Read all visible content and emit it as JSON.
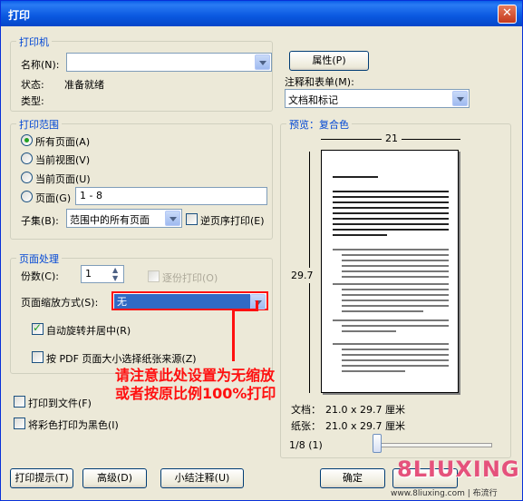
{
  "window": {
    "title": "打印",
    "close": "✕"
  },
  "printer": {
    "group_title": "打印机",
    "name_label": "名称(N):",
    "properties_button": "属性(P)",
    "status_label": "状态:",
    "status_value": "准备就绪",
    "type_label": "类型:",
    "comments_label": "注释和表单(M):",
    "comments_value": "文档和标记"
  },
  "range": {
    "group_title": "打印范围",
    "options": [
      "所有页面(A)",
      "当前视图(V)",
      "当前页面(U)",
      "页面(G)"
    ],
    "pages_value": "1 - 8",
    "subset_label": "子集(B):",
    "subset_value": "范围中的所有页面",
    "reverse_label": "逆页序打印(E)"
  },
  "handling": {
    "group_title": "页面处理",
    "copies_label": "份数(C):",
    "copies_value": "1",
    "collate_label": "逐份打印(O)",
    "scaling_label": "页面缩放方式(S):",
    "scaling_value": "无",
    "auto_rotate_label": "自动旋转并居中(R)",
    "pdf_page_size_label": "按 PDF 页面大小选择纸张来源(Z)"
  },
  "print_to_file": "打印到文件(F)",
  "grayscale": "将彩色打印为黑色(I)",
  "preview": {
    "title": "预览：复合色",
    "width_label": "21",
    "height_label": "29.7",
    "doc_label": "文档：",
    "doc_value": "21.0 x 29.7 厘米",
    "paper_label": "纸张：",
    "paper_value": "21.0 x 29.7 厘米",
    "page_counter": "1/8 (1)",
    "slider_position": 0.0
  },
  "annotation": {
    "line1": "请注意此处设置为无缩放",
    "line2": "或者按原比例100%打印",
    "color": "#ff1010"
  },
  "buttons": {
    "tips": "打印提示(T)",
    "advanced": "高级(D)",
    "summarize": "小结注释(U)",
    "ok": "确定"
  },
  "watermark": {
    "logo": "8LIUXING",
    "url": "www.8liuxing.com | 布流行"
  }
}
